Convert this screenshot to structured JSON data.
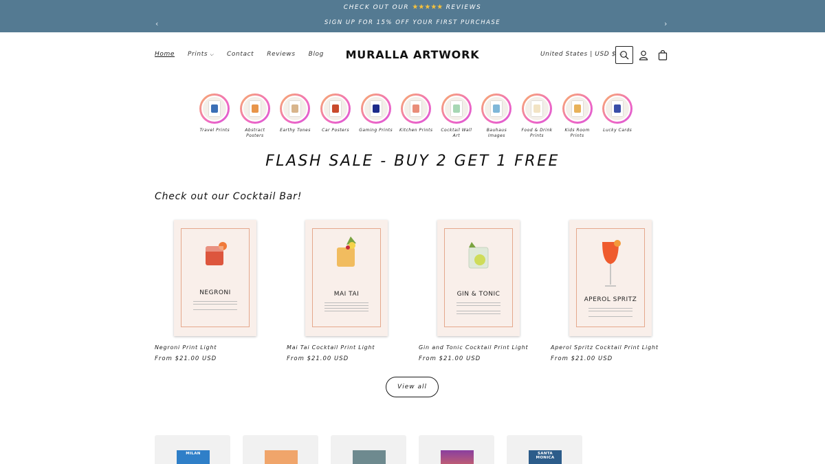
{
  "announcement": {
    "line1_before": "CHECK OUT OUR",
    "line1_stars": "★★★★★",
    "line1_after": "REVIEWS",
    "line2": "SIGN UP FOR 15% OFF YOUR FIRST PURCHASE",
    "prev_glyph": "‹",
    "next_glyph": "›"
  },
  "nav": {
    "home": "Home",
    "prints": "Prints",
    "contact": "Contact",
    "reviews": "Reviews",
    "blog": "Blog"
  },
  "brand": "MURALLA ARTWORK",
  "region": "United States | USD $",
  "categories": [
    {
      "label": "Travel Prints",
      "color": "#3b6fb6"
    },
    {
      "label": "Abstract Posters",
      "color": "#e8954a"
    },
    {
      "label": "Earthy Tones",
      "color": "#d8b58c"
    },
    {
      "label": "Car Posters",
      "color": "#c94a2c"
    },
    {
      "label": "Gaming Prints",
      "color": "#1d2b8a"
    },
    {
      "label": "Kitchen Prints",
      "color": "#e98e7a"
    },
    {
      "label": "Cocktail Wall Art",
      "color": "#a7d7b4"
    },
    {
      "label": "Bauhaus Images",
      "color": "#7fb7d8"
    },
    {
      "label": "Food & Drink Prints",
      "color": "#f2e3c4"
    },
    {
      "label": "Kids Room Prints",
      "color": "#e8b25a"
    },
    {
      "label": "Lucky Cards",
      "color": "#3a4fa8"
    }
  ],
  "flash_sale": "FLASH SALE - BUY 2 GET 1 FREE",
  "section_title": "Check out our Cocktail Bar!",
  "products": [
    {
      "poster_title": "NEGRONI",
      "name": "Negroni Print Light",
      "price": "From $21.00 USD",
      "drink_color": "#d9452b"
    },
    {
      "poster_title": "MAI TAI",
      "name": "Mai Tai Cocktail Print Light",
      "price": "From $21.00 USD",
      "drink_color": "#f0b650"
    },
    {
      "poster_title": "GIN & TONIC",
      "name": "Gin and Tonic Cocktail Print Light",
      "price": "From $21.00 USD",
      "drink_color": "#dfe9d8"
    },
    {
      "poster_title": "APEROL SPRITZ",
      "name": "Aperol Spritz Cocktail Print Light",
      "price": "From $21.00 USD",
      "drink_color": "#ef5b2e"
    }
  ],
  "view_all": "View all",
  "strip": [
    {
      "label": "MILAN",
      "color": "#2f7fc8"
    },
    {
      "label": "",
      "color": "#f0a56b"
    },
    {
      "label": "",
      "color": "#6e8a8f"
    },
    {
      "label": "",
      "color": "#8a3fa0"
    },
    {
      "label": "SANTA MONICA",
      "color": "#2c5c8a"
    }
  ]
}
